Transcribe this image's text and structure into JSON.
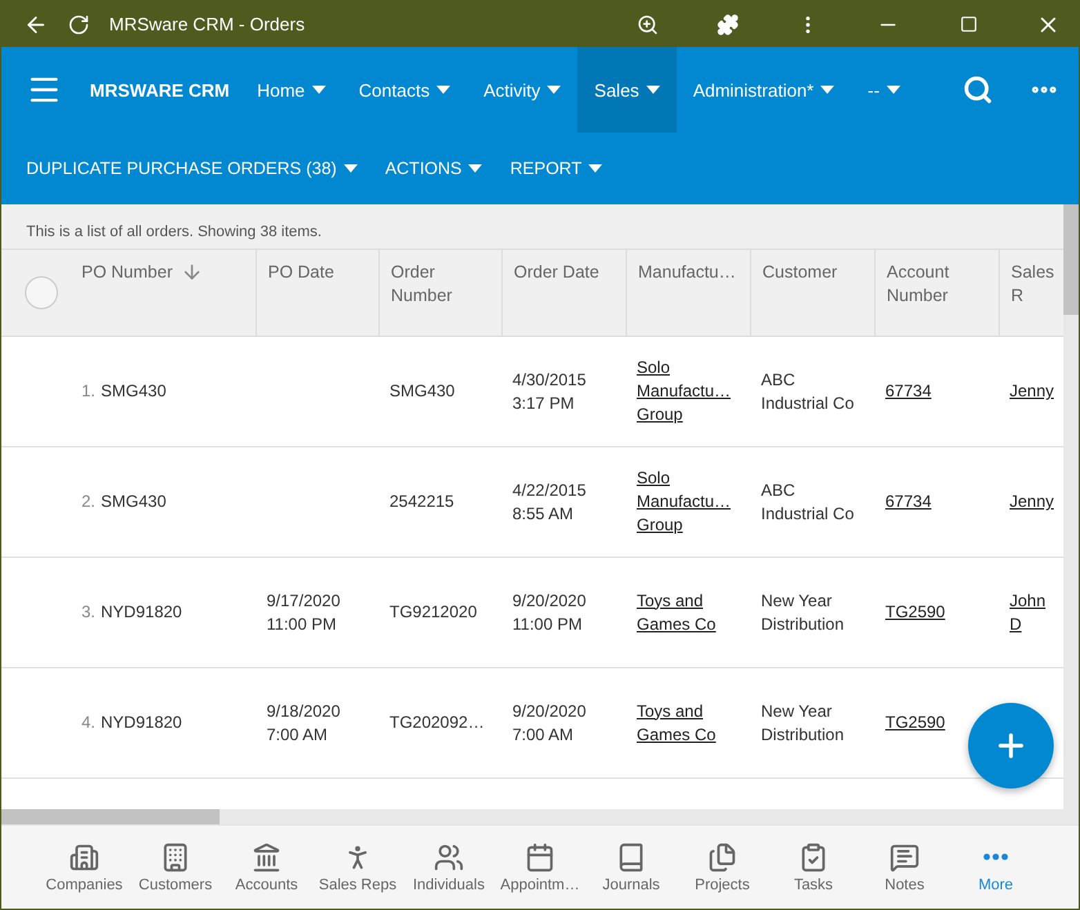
{
  "window": {
    "title": "MRSware CRM - Orders"
  },
  "nav": {
    "brand": "MRSWARE CRM",
    "items": [
      {
        "label": "Home",
        "selected": false
      },
      {
        "label": "Contacts",
        "selected": false
      },
      {
        "label": "Activity",
        "selected": false
      },
      {
        "label": "Sales",
        "selected": true
      },
      {
        "label": "Administration*",
        "selected": false
      },
      {
        "label": "--",
        "selected": false
      }
    ]
  },
  "subbar": [
    {
      "label": "DUPLICATE PURCHASE ORDERS (38)"
    },
    {
      "label": "ACTIONS"
    },
    {
      "label": "REPORT"
    }
  ],
  "info": "This is a list of all orders. Showing 38 items.",
  "table": {
    "select_all": {
      "checked": false
    },
    "columns": [
      {
        "label": "PO Number",
        "sorted": true
      },
      {
        "label": "PO Date",
        "sorted": false
      },
      {
        "label": "Order Number",
        "sorted": false
      },
      {
        "label": "Order Date",
        "sorted": false
      },
      {
        "label": "Manufactu…",
        "sorted": false
      },
      {
        "label": "Customer",
        "sorted": false
      },
      {
        "label": "Account Number",
        "sorted": false
      },
      {
        "label": "Sales R",
        "sorted": false
      }
    ],
    "rows": [
      {
        "index": "1.",
        "cells": [
          {
            "text": "SMG430",
            "kind": "text"
          },
          {
            "kind": "empty"
          },
          {
            "text": "SMG430",
            "kind": "text"
          },
          {
            "text": "4/30/2015 3:17 PM",
            "kind": "text"
          },
          {
            "text": "Solo Manufactu… Group",
            "kind": "link"
          },
          {
            "text": "ABC Industrial Co",
            "kind": "text"
          },
          {
            "text": "67734",
            "kind": "link"
          },
          {
            "text": "Jenny",
            "kind": "link"
          }
        ]
      },
      {
        "index": "2.",
        "cells": [
          {
            "text": "SMG430",
            "kind": "text"
          },
          {
            "kind": "empty"
          },
          {
            "text": "2542215",
            "kind": "text"
          },
          {
            "text": "4/22/2015 8:55 AM",
            "kind": "text"
          },
          {
            "text": "Solo Manufactu… Group",
            "kind": "link"
          },
          {
            "text": "ABC Industrial Co",
            "kind": "text"
          },
          {
            "text": "67734",
            "kind": "link"
          },
          {
            "text": "Jenny",
            "kind": "link"
          }
        ]
      },
      {
        "index": "3.",
        "cells": [
          {
            "text": "NYD91820",
            "kind": "text"
          },
          {
            "text": "9/17/2020 11:00 PM",
            "kind": "text"
          },
          {
            "text": "TG9212020",
            "kind": "text"
          },
          {
            "text": "9/20/2020 11:00 PM",
            "kind": "text"
          },
          {
            "text": "Toys and Games Co",
            "kind": "link"
          },
          {
            "text": "New Year Distribution",
            "kind": "text"
          },
          {
            "text": "TG2590",
            "kind": "link"
          },
          {
            "text": "John D",
            "kind": "link"
          }
        ]
      },
      {
        "index": "4.",
        "cells": [
          {
            "text": "NYD91820",
            "kind": "text"
          },
          {
            "text": "9/18/2020 7:00 AM",
            "kind": "text"
          },
          {
            "text": "TG202092…",
            "kind": "text"
          },
          {
            "text": "9/20/2020 7:00 AM",
            "kind": "text"
          },
          {
            "text": "Toys and Games Co",
            "kind": "link"
          },
          {
            "text": "New Year Distribution",
            "kind": "text"
          },
          {
            "text": "TG2590",
            "kind": "link"
          }
        ]
      }
    ]
  },
  "bottom_nav": [
    {
      "label": "Companies",
      "kind": "companies",
      "selected": false
    },
    {
      "label": "Customers",
      "kind": "customers",
      "selected": false
    },
    {
      "label": "Accounts",
      "kind": "accounts",
      "selected": false
    },
    {
      "label": "Sales Reps",
      "kind": "reps",
      "selected": false
    },
    {
      "label": "Individuals",
      "kind": "individuals",
      "selected": false
    },
    {
      "label": "Appointm…",
      "kind": "appointments",
      "selected": false
    },
    {
      "label": "Journals",
      "kind": "journals",
      "selected": false
    },
    {
      "label": "Projects",
      "kind": "projects",
      "selected": false
    },
    {
      "label": "Tasks",
      "kind": "tasks",
      "selected": false
    },
    {
      "label": "Notes",
      "kind": "notes",
      "selected": false
    },
    {
      "label": "More",
      "kind": "more",
      "selected": true
    }
  ]
}
